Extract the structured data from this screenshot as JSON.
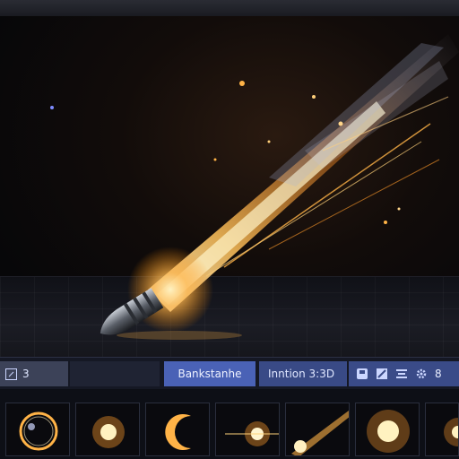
{
  "toolbar": {
    "left_value": "3",
    "name_field": "Bankstanhe",
    "mode_label": "Inntion 3:3D",
    "right_value": "8"
  },
  "thumbnails": [
    {
      "label": "ring-glow"
    },
    {
      "label": "spark-burst"
    },
    {
      "label": "crescent-flare"
    },
    {
      "label": "star-flash"
    },
    {
      "label": "streak-trail"
    },
    {
      "label": "radial-burst"
    },
    {
      "label": "partial-burst"
    }
  ],
  "colors": {
    "toolbar_bg": "#151824",
    "name_field_bg": "#4a62b6",
    "accent_glow": "#ffb347"
  }
}
